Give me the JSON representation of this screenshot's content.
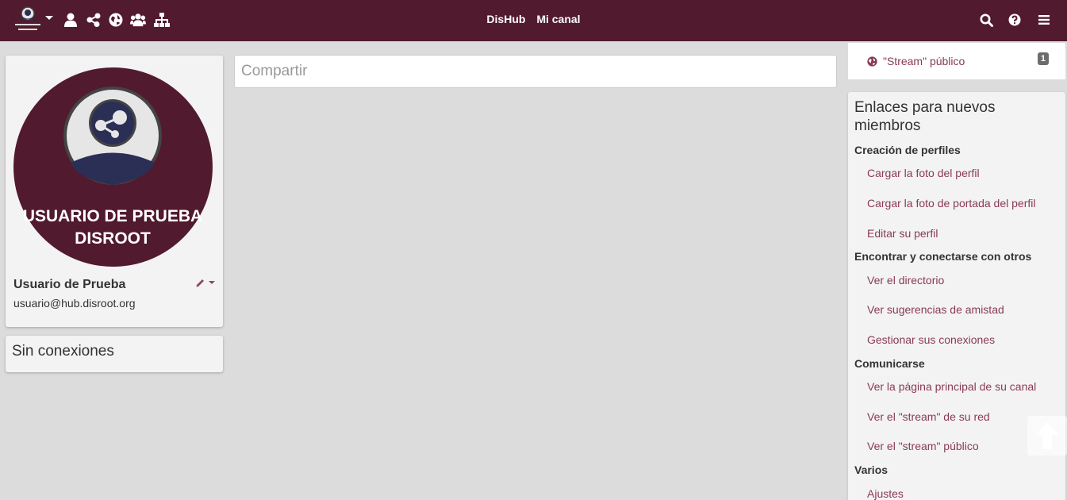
{
  "navbar": {
    "brand": "DisHub",
    "channel": "Mi canal",
    "icons": [
      "user-icon",
      "share-nodes-icon",
      "globe-icon",
      "group-icon",
      "sitemap-icon"
    ],
    "right_icons": [
      "search-icon",
      "help-icon",
      "menu-icon"
    ],
    "color": "#521a2e"
  },
  "profile": {
    "name": "Usuario de Prueba",
    "address": "usuario@hub.disroot.org",
    "photo_text_line1": "USUARIO DE PRUEBA",
    "photo_text_line2": "DISROOT"
  },
  "connections": {
    "title": "Sin conexiones"
  },
  "share": {
    "placeholder": "Compartir"
  },
  "stream": {
    "label": "\"Stream\" público",
    "badge": "1"
  },
  "links": {
    "title": "Enlaces para nuevos miembros",
    "sections": [
      {
        "heading": "Creación de perfiles",
        "items": [
          "Cargar la foto del perfil",
          "Cargar la foto de portada del perfil",
          "Editar su perfil"
        ]
      },
      {
        "heading": "Encontrar y conectarse con otros",
        "items": [
          "Ver el directorio",
          "Ver sugerencias de amistad",
          "Gestionar sus conexiones"
        ]
      },
      {
        "heading": "Comunicarse",
        "items": [
          "Ver la página principal de su canal",
          "Ver el \"stream\" de su red",
          "Ver el \"stream\" público"
        ]
      },
      {
        "heading": "Varios",
        "items": [
          "Ajustes"
        ]
      }
    ]
  },
  "colors": {
    "accent": "#521a2e",
    "link": "#8a3a52",
    "background": "#dcdcdc",
    "card": "#f3f3f3"
  }
}
